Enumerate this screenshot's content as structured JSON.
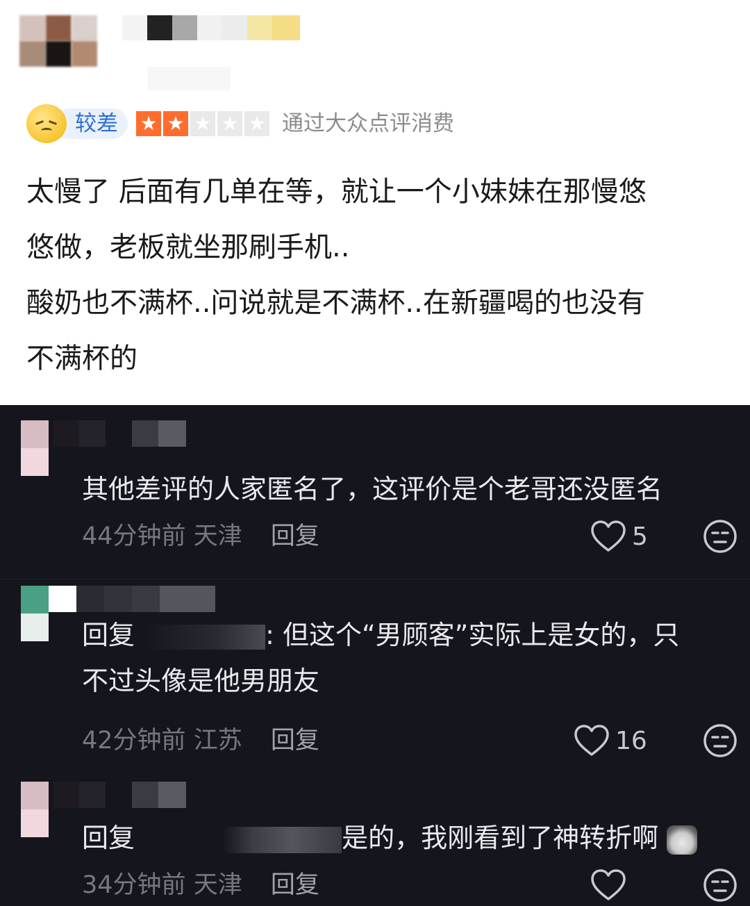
{
  "review": {
    "rating_label": "较差",
    "stars_filled": 2,
    "stars_total": 5,
    "source": "通过大众点评消费",
    "body_lines": [
      "太慢了 后面有几单在等，就让一个小妹妹在那慢悠",
      "悠做，老板就坐那刷手机..",
      "酸奶也不满杯..问说就是不满杯..在新疆喝的也没有",
      "不满杯的"
    ],
    "icons": {
      "rating_face": "sad-face-icon",
      "star": "star-icon"
    },
    "colors": {
      "star_on": "#ff6d2e",
      "badge_text": "#2f6fd6"
    }
  },
  "comments": [
    {
      "text_lines": [
        "其他差评的人家匿名了，这评价是个老哥还没匿名"
      ],
      "time": "44分钟前",
      "location": "天津",
      "reply_label": "回复",
      "likes": "5"
    },
    {
      "reply_prefix": "回复",
      "text_lines_after": ": 但这个“男顾客”实际上是女的，只",
      "text_line2": "不过头像是他男朋友",
      "time": "42分钟前",
      "location": "江苏",
      "reply_label": "回复",
      "likes": "16"
    },
    {
      "reply_prefix": "回复",
      "text_after": "是的，我刚看到了神转折啊",
      "time": "34分钟前",
      "location": "天津",
      "reply_label": "回复",
      "likes": ""
    }
  ],
  "theme": {
    "dark_bg": "#15151d",
    "icons": [
      "heart-icon",
      "face-icon",
      "cat-emoji-icon"
    ]
  }
}
